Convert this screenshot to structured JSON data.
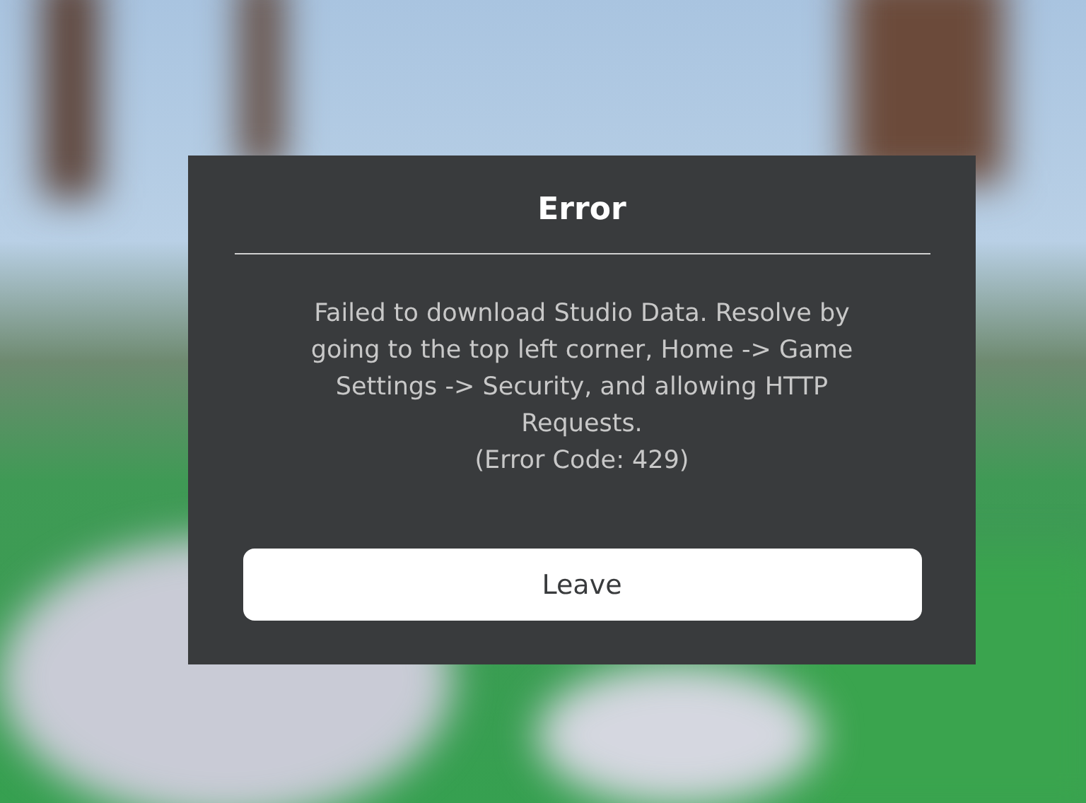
{
  "dialog": {
    "title": "Error",
    "message": "Failed to download Studio Data. Resolve by going to the top left corner, Home -> Game Settings -> Security, and allowing HTTP Requests.",
    "error_code": "(Error Code: 429)",
    "buttons": [
      {
        "label": "Leave"
      }
    ]
  }
}
